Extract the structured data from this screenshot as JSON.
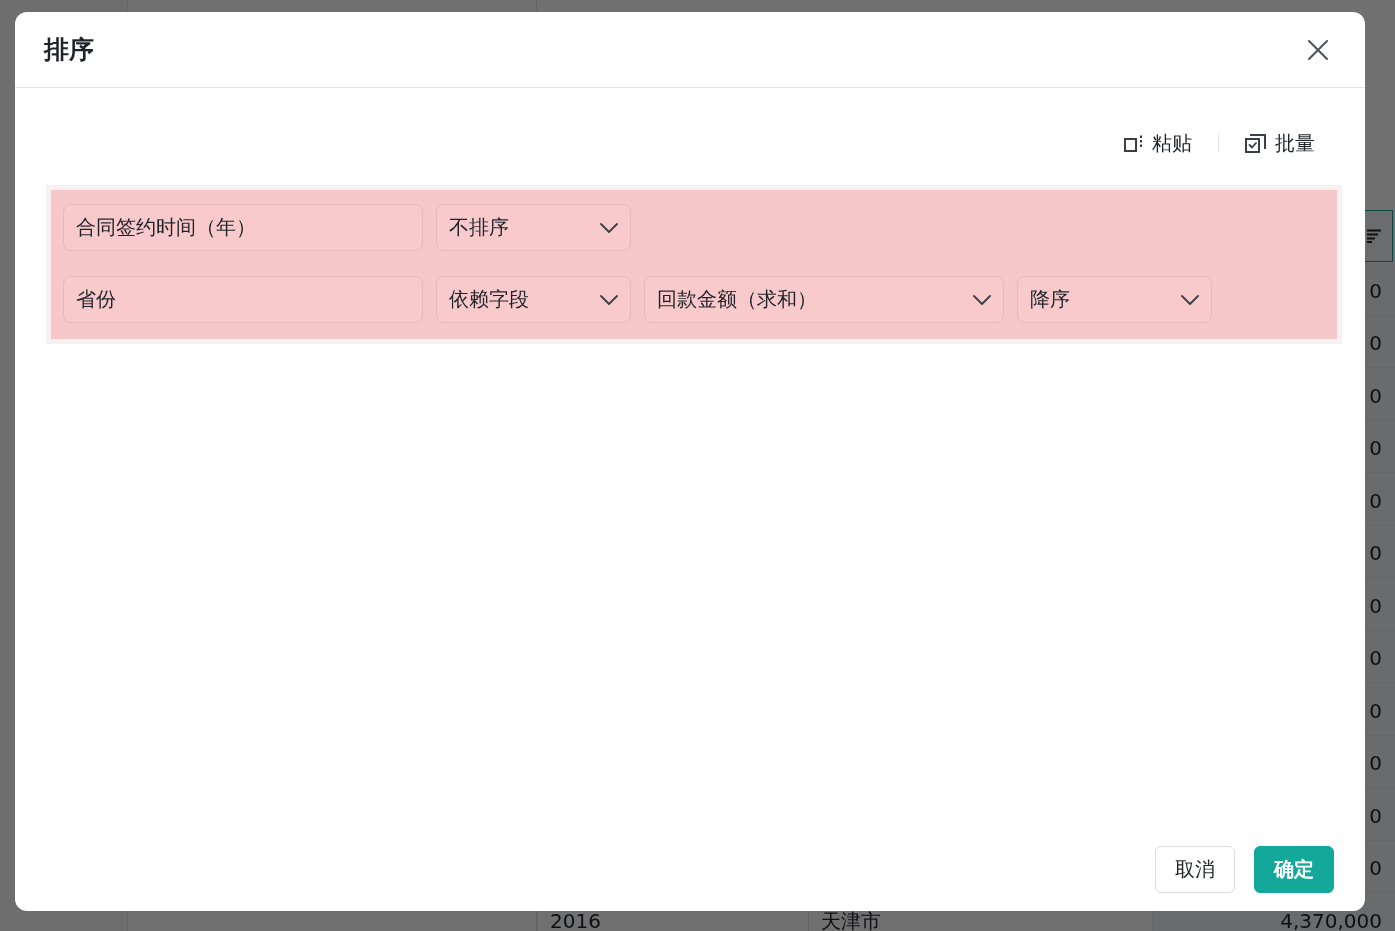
{
  "background": {
    "table": {
      "rows": [
        {
          "column_3": "0"
        },
        {
          "column_3": "0"
        },
        {
          "column_3": "0"
        },
        {
          "column_3": "0"
        },
        {
          "column_3": "0"
        },
        {
          "column_3": "0"
        },
        {
          "column_3": "0"
        },
        {
          "column_3": "0"
        },
        {
          "column_3": "0"
        },
        {
          "column_3": "0"
        },
        {
          "column_3": "0"
        },
        {
          "column_3": "0"
        },
        {
          "column_1": "2016",
          "column_2": "天津市",
          "column_3": "4,370,000"
        }
      ]
    }
  },
  "dialog": {
    "title": "排序",
    "toolbar": [
      {
        "kind": "paste",
        "label": "粘贴"
      },
      {
        "kind": "batch",
        "label": "批量"
      }
    ],
    "sort_panel": {
      "highlighted": true,
      "rules": [
        {
          "field": "合同签约时间（年）",
          "mode": "不排序"
        },
        {
          "field": "省份",
          "mode": "依赖字段",
          "depends_on": "回款金额（求和）",
          "order": "降序"
        }
      ]
    },
    "buttons": [
      {
        "kind": "secondary",
        "label": "取消"
      },
      {
        "kind": "primary",
        "label": "确定"
      }
    ]
  }
}
